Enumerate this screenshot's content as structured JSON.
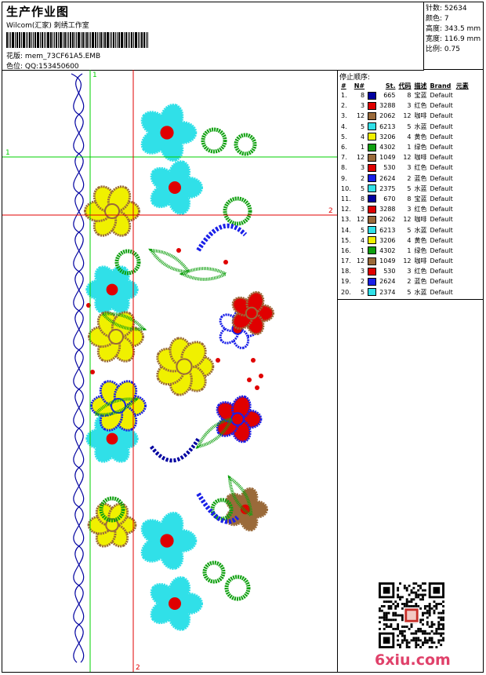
{
  "header": {
    "title": "生产作业图",
    "company": "Wilcom(汇家) 刺绣工作室",
    "design_label": "花版:",
    "design_name": "mem_73CF61A5.EMB",
    "color_label": "色位:",
    "color_value": "QQ:153450600"
  },
  "stats": [
    {
      "label": "针数:",
      "value": "52634"
    },
    {
      "label": "颜色:",
      "value": "7"
    },
    {
      "label": "高度:",
      "value": "343.5 mm"
    },
    {
      "label": "宽度:",
      "value": "116.9 mm"
    },
    {
      "label": "比例:",
      "value": "0.75"
    }
  ],
  "guides": {
    "green_vertical_label": "1",
    "green_horizontal_label": "1",
    "red_horizontal_label": "2",
    "red_vertical_label": "2"
  },
  "stop_sequence": {
    "title": "停止顺序:",
    "columns": [
      "#",
      "N#",
      "St.",
      "代码",
      "描述",
      "Brand",
      "元素"
    ],
    "rows": [
      {
        "idx": "1.",
        "n": "8",
        "color": "#0000a0",
        "st": "665",
        "code": "8",
        "desc": "宝蓝",
        "brand": "Default"
      },
      {
        "idx": "2.",
        "n": "3",
        "color": "#e00000",
        "st": "3288",
        "code": "3",
        "desc": "红色",
        "brand": "Default"
      },
      {
        "idx": "3.",
        "n": "12",
        "color": "#9a6a3a",
        "st": "2062",
        "code": "12",
        "desc": "咖啡",
        "brand": "Default"
      },
      {
        "idx": "4.",
        "n": "5",
        "color": "#30e0e8",
        "st": "6213",
        "code": "5",
        "desc": "水蓝",
        "brand": "Default"
      },
      {
        "idx": "5.",
        "n": "4",
        "color": "#f0f000",
        "st": "3206",
        "code": "4",
        "desc": "黄色",
        "brand": "Default"
      },
      {
        "idx": "6.",
        "n": "1",
        "color": "#10a010",
        "st": "4302",
        "code": "1",
        "desc": "绿色",
        "brand": "Default"
      },
      {
        "idx": "7.",
        "n": "12",
        "color": "#9a6a3a",
        "st": "1049",
        "code": "12",
        "desc": "咖啡",
        "brand": "Default"
      },
      {
        "idx": "8.",
        "n": "3",
        "color": "#e00000",
        "st": "530",
        "code": "3",
        "desc": "红色",
        "brand": "Default"
      },
      {
        "idx": "9.",
        "n": "2",
        "color": "#1a20e8",
        "st": "2624",
        "code": "2",
        "desc": "蓝色",
        "brand": "Default"
      },
      {
        "idx": "10.",
        "n": "5",
        "color": "#30e0e8",
        "st": "2375",
        "code": "5",
        "desc": "水蓝",
        "brand": "Default"
      },
      {
        "idx": "11.",
        "n": "8",
        "color": "#0000a0",
        "st": "670",
        "code": "8",
        "desc": "宝蓝",
        "brand": "Default"
      },
      {
        "idx": "12.",
        "n": "3",
        "color": "#e00000",
        "st": "3288",
        "code": "3",
        "desc": "红色",
        "brand": "Default"
      },
      {
        "idx": "13.",
        "n": "12",
        "color": "#9a6a3a",
        "st": "2062",
        "code": "12",
        "desc": "咖啡",
        "brand": "Default"
      },
      {
        "idx": "14.",
        "n": "5",
        "color": "#30e0e8",
        "st": "6213",
        "code": "5",
        "desc": "水蓝",
        "brand": "Default"
      },
      {
        "idx": "15.",
        "n": "4",
        "color": "#f0f000",
        "st": "3206",
        "code": "4",
        "desc": "黄色",
        "brand": "Default"
      },
      {
        "idx": "16.",
        "n": "1",
        "color": "#10a010",
        "st": "4302",
        "code": "1",
        "desc": "绿色",
        "brand": "Default"
      },
      {
        "idx": "17.",
        "n": "12",
        "color": "#9a6a3a",
        "st": "1049",
        "code": "12",
        "desc": "咖啡",
        "brand": "Default"
      },
      {
        "idx": "18.",
        "n": "3",
        "color": "#e00000",
        "st": "530",
        "code": "3",
        "desc": "红色",
        "brand": "Default"
      },
      {
        "idx": "19.",
        "n": "2",
        "color": "#1a20e8",
        "st": "2624",
        "code": "2",
        "desc": "蓝色",
        "brand": "Default"
      },
      {
        "idx": "20.",
        "n": "5",
        "color": "#30e0e8",
        "st": "2374",
        "code": "5",
        "desc": "水蓝",
        "brand": "Default"
      }
    ]
  },
  "watermark": "6xiu.com",
  "colors": {
    "guide_green": "#00d000",
    "guide_red": "#e00000",
    "outline_navy": "#000080",
    "logo_pink": "#e0416a"
  }
}
